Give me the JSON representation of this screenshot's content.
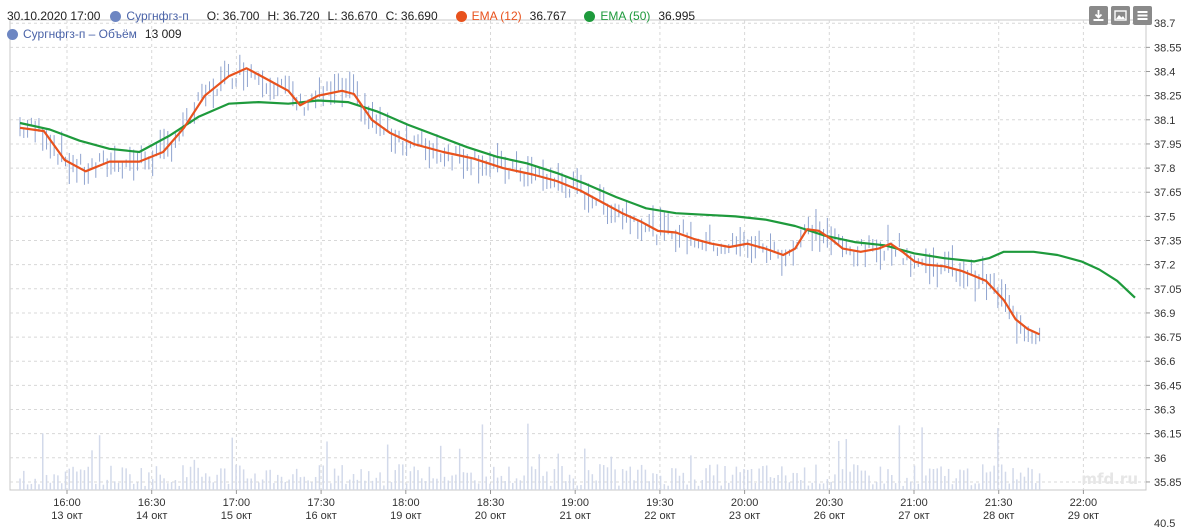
{
  "legend": {
    "datetime": "30.10.2020 17:00",
    "symbol": "Сургнфгз-п",
    "open_label": "O:",
    "open": "36.700",
    "high_label": "H:",
    "high": "36.720",
    "low_label": "L:",
    "low": "36.670",
    "close_label": "C:",
    "close": "36.690",
    "ema12_label": "EMA (12)",
    "ema12_value": "36.767",
    "ema50_label": "EMA (50)",
    "ema50_value": "36.995",
    "volume_label": "Сургнфгз-п – Объём",
    "volume_value": "13 009"
  },
  "colors": {
    "price": "#8fa3cf",
    "volume": "#d2d9ea",
    "ema12": "#e8521d",
    "ema50": "#1e9a3c",
    "symbol_dot": "#6d86c2",
    "grid": "#d8d8d8",
    "axis_text": "#333333",
    "toolbar": "#8a8a8a"
  },
  "toolbar_icons": [
    "download-icon",
    "image-icon",
    "menu-icon"
  ],
  "watermark": "mfd.ru",
  "chart_data": {
    "type": "bar",
    "price_ticks": [
      "38.7",
      "38.55",
      "38.4",
      "38.25",
      "38.1",
      "37.95",
      "37.8",
      "37.65",
      "37.5",
      "37.35",
      "37.2",
      "37.05",
      "36.9",
      "36.75",
      "36.6",
      "36.45",
      "36.3",
      "36.15",
      "36",
      "35.85",
      "40.5"
    ],
    "price_range": [
      35.8,
      38.72
    ],
    "x_ticks": [
      {
        "time": "16:00",
        "date": "13 окт"
      },
      {
        "time": "16:30",
        "date": "14 окт"
      },
      {
        "time": "17:00",
        "date": "15 окт"
      },
      {
        "time": "17:30",
        "date": "16 окт"
      },
      {
        "time": "18:00",
        "date": "19 окт"
      },
      {
        "time": "18:30",
        "date": "20 окт"
      },
      {
        "time": "19:00",
        "date": "21 окт"
      },
      {
        "time": "19:30",
        "date": "22 окт"
      },
      {
        "time": "20:00",
        "date": "23 окт"
      },
      {
        "time": "20:30",
        "date": "26 окт"
      },
      {
        "time": "21:00",
        "date": "27 окт"
      },
      {
        "time": "21:30",
        "date": "28 окт"
      },
      {
        "time": "22:00",
        "date": "29 окт"
      }
    ],
    "bar_count": 270,
    "ema12_points": [
      [
        0,
        38.05
      ],
      [
        8,
        38.03
      ],
      [
        15,
        37.85
      ],
      [
        22,
        37.78
      ],
      [
        30,
        37.84
      ],
      [
        40,
        37.84
      ],
      [
        48,
        37.9
      ],
      [
        55,
        38.05
      ],
      [
        62,
        38.25
      ],
      [
        70,
        38.37
      ],
      [
        76,
        38.42
      ],
      [
        82,
        38.36
      ],
      [
        90,
        38.28
      ],
      [
        94,
        38.19
      ],
      [
        100,
        38.25
      ],
      [
        108,
        38.28
      ],
      [
        112,
        38.26
      ],
      [
        118,
        38.1
      ],
      [
        124,
        38.02
      ],
      [
        132,
        37.95
      ],
      [
        142,
        37.9
      ],
      [
        152,
        37.86
      ],
      [
        162,
        37.8
      ],
      [
        172,
        37.76
      ],
      [
        180,
        37.72
      ],
      [
        188,
        37.66
      ],
      [
        196,
        37.58
      ],
      [
        202,
        37.52
      ],
      [
        208,
        37.47
      ],
      [
        214,
        37.41
      ],
      [
        220,
        37.4
      ],
      [
        226,
        37.36
      ],
      [
        232,
        37.33
      ],
      [
        238,
        37.31
      ],
      [
        244,
        37.33
      ],
      [
        250,
        37.3
      ],
      [
        256,
        37.26
      ],
      [
        260,
        37.3
      ],
      [
        264,
        37.42
      ],
      [
        268,
        37.41
      ],
      [
        272,
        37.36
      ],
      [
        276,
        37.3
      ],
      [
        282,
        37.28
      ],
      [
        288,
        37.3
      ],
      [
        292,
        37.33
      ],
      [
        296,
        37.28
      ],
      [
        300,
        37.22
      ],
      [
        304,
        37.2
      ],
      [
        310,
        37.19
      ],
      [
        316,
        37.16
      ],
      [
        320,
        37.13
      ],
      [
        324,
        37.1
      ],
      [
        326,
        37.06
      ],
      [
        330,
        36.98
      ],
      [
        334,
        36.86
      ],
      [
        338,
        36.8
      ],
      [
        342,
        36.767
      ]
    ],
    "ema50_points": [
      [
        0,
        38.08
      ],
      [
        10,
        38.04
      ],
      [
        20,
        37.97
      ],
      [
        30,
        37.92
      ],
      [
        40,
        37.9
      ],
      [
        50,
        38.0
      ],
      [
        60,
        38.12
      ],
      [
        70,
        38.2
      ],
      [
        80,
        38.21
      ],
      [
        90,
        38.2
      ],
      [
        100,
        38.22
      ],
      [
        110,
        38.21
      ],
      [
        120,
        38.15
      ],
      [
        130,
        38.07
      ],
      [
        140,
        38.0
      ],
      [
        150,
        37.93
      ],
      [
        160,
        37.87
      ],
      [
        170,
        37.83
      ],
      [
        180,
        37.77
      ],
      [
        190,
        37.7
      ],
      [
        200,
        37.62
      ],
      [
        210,
        37.55
      ],
      [
        220,
        37.52
      ],
      [
        230,
        37.51
      ],
      [
        240,
        37.5
      ],
      [
        250,
        37.48
      ],
      [
        260,
        37.44
      ],
      [
        270,
        37.38
      ],
      [
        280,
        37.34
      ],
      [
        290,
        37.32
      ],
      [
        300,
        37.27
      ],
      [
        310,
        37.24
      ],
      [
        320,
        37.22
      ],
      [
        325,
        37.24
      ],
      [
        330,
        37.28
      ],
      [
        335,
        37.28
      ],
      [
        340,
        37.28
      ],
      [
        348,
        37.26
      ],
      [
        356,
        37.22
      ],
      [
        362,
        37.17
      ],
      [
        368,
        37.1
      ],
      [
        374,
        36.995
      ]
    ]
  }
}
